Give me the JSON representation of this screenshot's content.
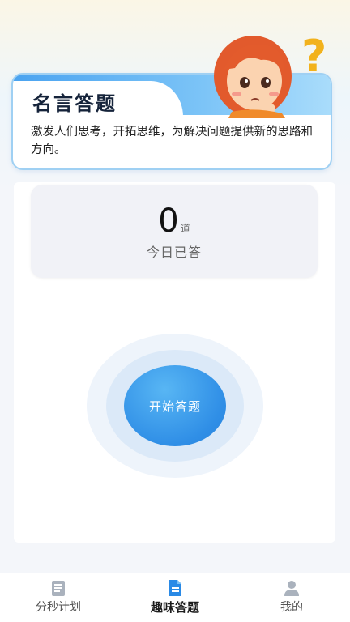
{
  "header": {
    "title": "名言答题",
    "description": "激发人们思考，开拓思维，为解决问题提供新的思路和方向。"
  },
  "stats": {
    "count": "0",
    "unit": "道",
    "label": "今日已答"
  },
  "start_button": {
    "label": "开始答题"
  },
  "nav": {
    "items": [
      {
        "label": "分秒计划",
        "icon": "notebook-icon"
      },
      {
        "label": "趣味答题",
        "icon": "document-icon"
      },
      {
        "label": "我的",
        "icon": "person-icon"
      }
    ],
    "active_index": 1
  },
  "colors": {
    "accent": "#2f8ee6",
    "band": "#4aa3f0",
    "nav_active": "#2a8ae6",
    "nav_inactive": "#9aa3ad"
  }
}
